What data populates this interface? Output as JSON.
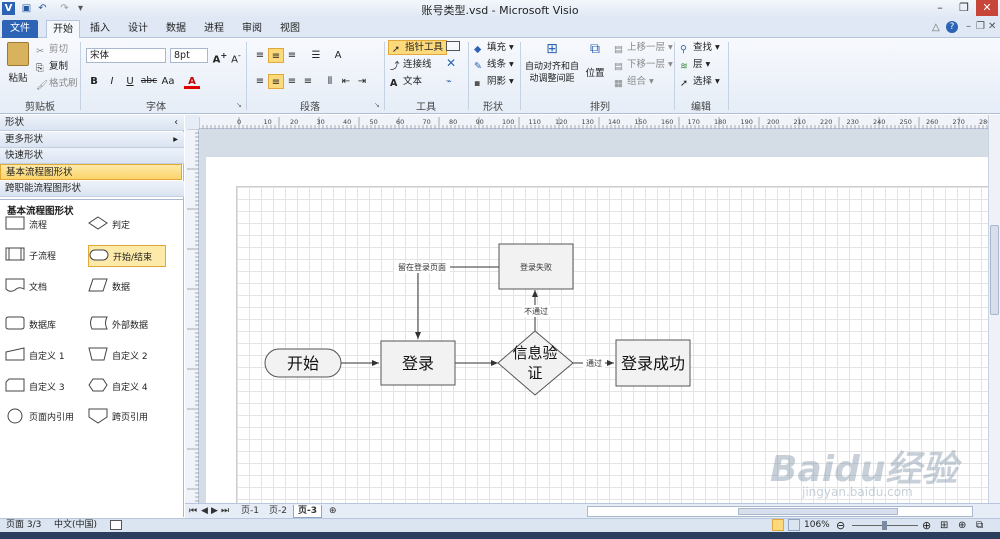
{
  "window": {
    "title": "账号类型.vsd - Microsoft Visio"
  },
  "tabs": [
    "文件",
    "开始",
    "插入",
    "设计",
    "数据",
    "进程",
    "审阅",
    "视图"
  ],
  "clipboard": {
    "paste": "粘贴",
    "cut": "剪切",
    "copy": "复制",
    "format_painter": "格式刷",
    "label": "剪贴板"
  },
  "font": {
    "name": "宋体",
    "size": "8pt",
    "label": "字体",
    "bold": "B",
    "italic": "I",
    "underline": "U",
    "strike": "abc",
    "case": "Aa",
    "color": "A"
  },
  "paragraph": {
    "label": "段落"
  },
  "tools": {
    "pointer": "指针工具",
    "connector": "连接线",
    "text": "文本",
    "label": "工具"
  },
  "shape": {
    "fill": "填充",
    "line": "线条",
    "shadow": "阴影",
    "label": "形状"
  },
  "arrange": {
    "auto": "自动对齐和自动调整间距",
    "position": "位置",
    "bring_forward": "上移一层",
    "send_backward": "下移一层",
    "group": "组合",
    "label": "排列"
  },
  "edit": {
    "find": "查找",
    "layers": "层",
    "select": "选择",
    "label": "编辑"
  },
  "panel": {
    "header": "形状",
    "more": "更多形状",
    "quick": "快速形状",
    "basic": "基本流程图形状",
    "cross": "跨职能流程图形状",
    "stencil_title": "基本流程图形状",
    "items": [
      "流程",
      "判定",
      "子流程",
      "开始/结束",
      "文档",
      "数据",
      "数据库",
      "外部数据",
      "自定义 1",
      "自定义 2",
      "自定义 3",
      "自定义 4",
      "页面内引用",
      "跨页引用"
    ]
  },
  "diagram": {
    "start": "开始",
    "login": "登录",
    "verify": "信息验证",
    "success": "登录成功",
    "fail": "登录失败",
    "stay": "留在登录页面",
    "pass": "通过",
    "nopass": "不通过"
  },
  "pages": [
    "页-1",
    "页-2",
    "页-3"
  ],
  "status": {
    "page": "页面 3/3",
    "lang": "中文(中国)",
    "zoom": "106%"
  },
  "watermark": {
    "brand": "Baidu经验",
    "url": "jingyan.baidu.com"
  },
  "ruler_top": [
    "0",
    "10",
    "20",
    "30",
    "40",
    "50",
    "60",
    "70",
    "80",
    "90",
    "100",
    "110",
    "120",
    "130",
    "140",
    "150",
    "160",
    "170",
    "180",
    "190",
    "200",
    "210",
    "220",
    "230",
    "240",
    "250",
    "260",
    "270",
    "280"
  ]
}
